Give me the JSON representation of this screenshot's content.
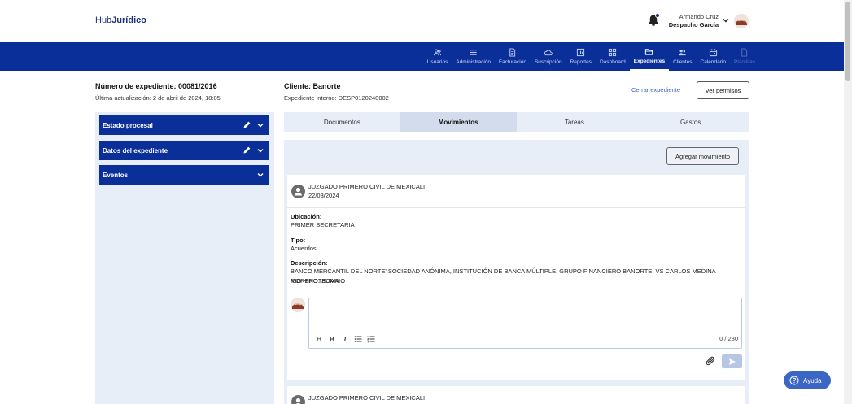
{
  "app": {
    "logo_light": "Hub",
    "logo_bold": "Jurídico"
  },
  "user": {
    "name": "Armando Cruz",
    "firm": "Despacho García"
  },
  "nav": {
    "items": [
      {
        "label": "Usuarios",
        "icon": "users-icon",
        "state": "normal"
      },
      {
        "label": "Administración",
        "icon": "menu-icon",
        "state": "normal"
      },
      {
        "label": "Facturación",
        "icon": "invoice-icon",
        "state": "normal"
      },
      {
        "label": "Suscripción",
        "icon": "cloud-icon",
        "state": "normal"
      },
      {
        "label": "Reportes",
        "icon": "report-icon",
        "state": "normal"
      },
      {
        "label": "Dashboard",
        "icon": "dashboard-icon",
        "state": "normal"
      },
      {
        "label": "Expedientes",
        "icon": "folder-icon",
        "state": "active"
      },
      {
        "label": "Clientes",
        "icon": "clients-icon",
        "state": "normal"
      },
      {
        "label": "Calendario",
        "icon": "calendar-icon",
        "state": "normal"
      },
      {
        "label": "Plantillas",
        "icon": "template-icon",
        "state": "disabled"
      }
    ]
  },
  "expediente": {
    "number": "Número de expediente: 00081/2016",
    "updated": "Última actualización: 2 de abril de 2024, 18:05",
    "client": "Cliente: Banorte",
    "internal": "Expediente interno: DESP0120240002",
    "close_label": "Cerrar expediente",
    "permissions_label": "Ver permisos"
  },
  "left_panel": {
    "sections": [
      {
        "label": "Estado procesal",
        "editable": true
      },
      {
        "label": "Datos del expediente",
        "editable": true
      },
      {
        "label": "Eventos",
        "editable": false
      }
    ]
  },
  "tabs": [
    {
      "label": "Documentos",
      "active": false
    },
    {
      "label": "Movimientos",
      "active": true
    },
    {
      "label": "Tareas",
      "active": false
    },
    {
      "label": "Gastos",
      "active": false
    }
  ],
  "movements": {
    "add_label": "Agregar movimiento",
    "items": [
      {
        "court": "JUZGADO PRIMERO CIVIL DE MEXICALI",
        "date": "22/03/2024",
        "ubicacion_label": "Ubicación:",
        "ubicacion": "PRIMER SECRETARIA",
        "tipo_label": "Tipo:",
        "tipo": "Acuerdos",
        "descripcion_label": "Descripción:",
        "descripcion_line1": "BANCO MERCANTIL DEL NORTE' SOCIEDAD ANÓNIMA, INSTITUCIÓN DE BANCA MÚLTIPLE, GRUPO FINANCIERO BANORTE, VS CARLOS MEDINA MORENO. SUMA",
        "descripcion_line2": "RIO HIPOTECARIO",
        "comment_counter": "0 / 280"
      },
      {
        "court": "JUZGADO PRIMERO CIVIL DE MEXICALI"
      }
    ]
  },
  "editor_tools": [
    "H",
    "B",
    "I"
  ],
  "help": {
    "label": "Ayuda"
  },
  "colors": {
    "primary": "#0b2f99",
    "panel": "#e7eef8",
    "help": "#3b66c4"
  }
}
